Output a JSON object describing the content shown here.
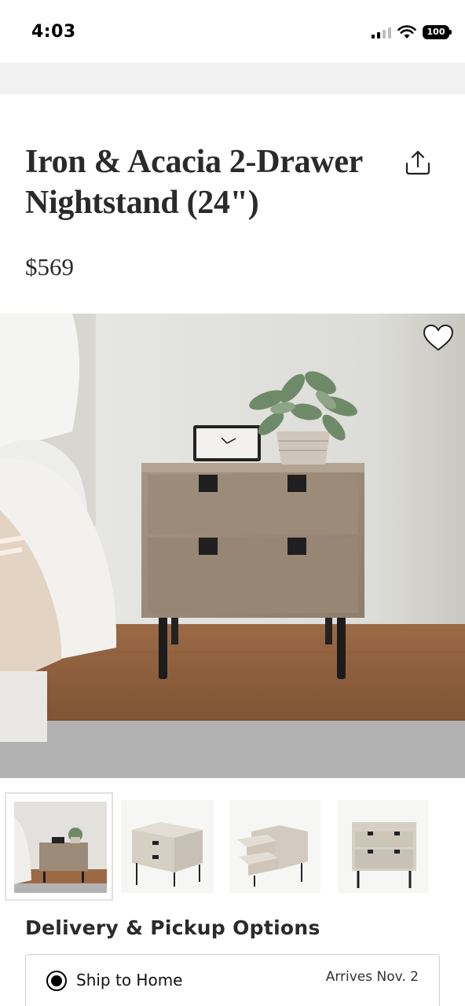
{
  "status_bar": {
    "time": "4:03",
    "battery": "100"
  },
  "product": {
    "title": "Iron & Acacia 2-Drawer Nightstand (24\")",
    "price": "$569"
  },
  "icons": {
    "share": "share-icon",
    "favorite": "heart-icon",
    "radio": "radio-selected-icon"
  },
  "gallery": {
    "thumbnails": [
      {
        "name": "room-scene",
        "selected": true
      },
      {
        "name": "front-angle",
        "selected": false
      },
      {
        "name": "open-drawers",
        "selected": false
      },
      {
        "name": "front-view",
        "selected": false
      }
    ]
  },
  "delivery": {
    "title": "Delivery & Pickup Options",
    "options": [
      {
        "label": "Ship to Home",
        "arrival": "Arrives Nov. 2",
        "selected": true
      }
    ]
  }
}
